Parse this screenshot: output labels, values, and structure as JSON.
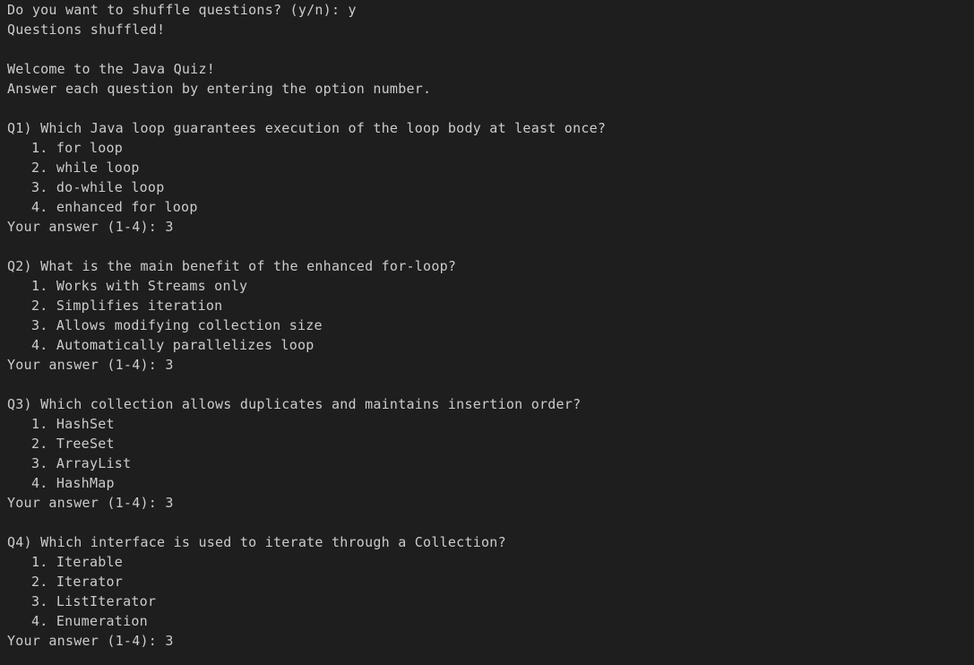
{
  "theme": {
    "background": "#1e1e1e",
    "foreground": "#cccccc"
  },
  "shuffle_prompt": "Do you want to shuffle questions? (y/n): ",
  "shuffle_input": "y",
  "shuffle_result": "Questions shuffled!",
  "welcome": "Welcome to the Java Quiz!",
  "instructions": "Answer each question by entering the option number.",
  "questions": [
    {
      "text": "Q1) Which Java loop guarantees execution of the loop body at least once?",
      "options": [
        "1. for loop",
        "2. while loop",
        "3. do-while loop",
        "4. enhanced for loop"
      ],
      "answer_prompt": "Your answer (1-4): ",
      "answer": "3"
    },
    {
      "text": "Q2) What is the main benefit of the enhanced for-loop?",
      "options": [
        "1. Works with Streams only",
        "2. Simplifies iteration",
        "3. Allows modifying collection size",
        "4. Automatically parallelizes loop"
      ],
      "answer_prompt": "Your answer (1-4): ",
      "answer": "3"
    },
    {
      "text": "Q3) Which collection allows duplicates and maintains insertion order?",
      "options": [
        "1. HashSet",
        "2. TreeSet",
        "3. ArrayList",
        "4. HashMap"
      ],
      "answer_prompt": "Your answer (1-4): ",
      "answer": "3"
    },
    {
      "text": "Q4) Which interface is used to iterate through a Collection?",
      "options": [
        "1. Iterable",
        "2. Iterator",
        "3. ListIterator",
        "4. Enumeration"
      ],
      "answer_prompt": "Your answer (1-4): ",
      "answer": "3"
    }
  ]
}
